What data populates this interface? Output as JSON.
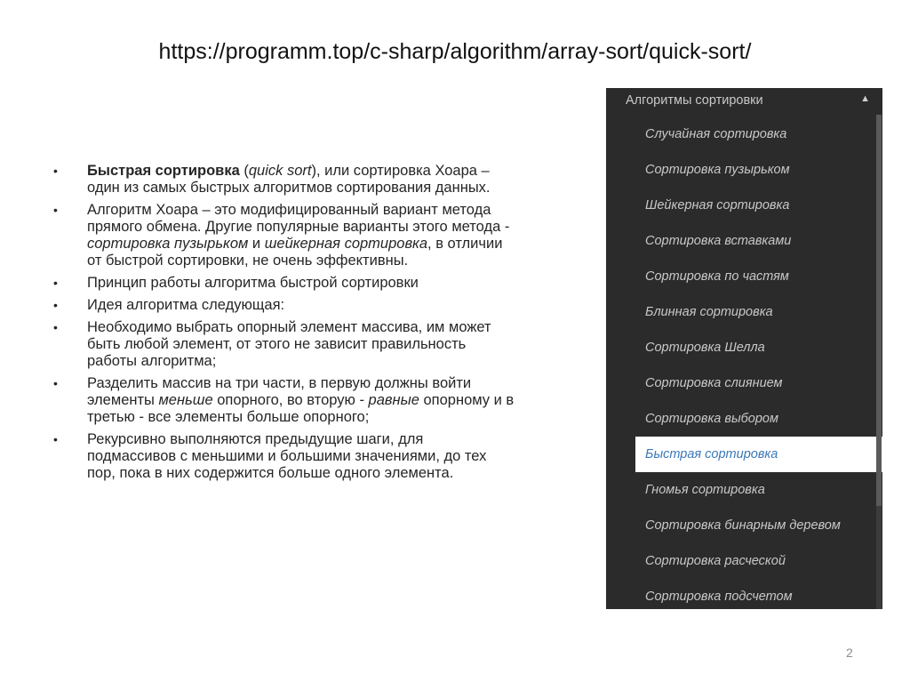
{
  "slide": {
    "title": "https://programm.top/c-sharp/algorithm/array-sort/quick-sort/",
    "page_number": "2"
  },
  "content": {
    "bullet_glyph": "•",
    "b1": {
      "bold": "Быстрая сортировка",
      "t1": " (",
      "i1": "quick sort",
      "t2": "), или сортировка Хоара – один из самых быстрых алгоритмов сортирования данных."
    },
    "b2": {
      "t1": "Алгоритм Хоара – это модифицированный вариант метода прямого обмена. Другие популярные варианты этого метода - ",
      "i1": "сортировка пузырьком",
      "t2": " и ",
      "i2": "шейкерная сортировка",
      "t3": ", в отличии от быстрой сортировки, не очень эффективны."
    },
    "b3": {
      "t1": "Принцип работы алгоритма быстрой сортировки"
    },
    "b4": {
      "t1": "Идея алгоритма следующая:"
    },
    "b5": {
      "t1": "Необходимо выбрать опорный элемент массива, им может быть любой элемент, от этого не зависит правильность работы алгоритма;"
    },
    "b6": {
      "t1": "Разделить массив на три части, в первую должны войти элементы ",
      "i1": "меньше",
      "t2": " опорного, во вторую -  ",
      "i2": "равные",
      "t3": " опорному и в третью - все элементы больше опорного;"
    },
    "b7": {
      "t1": "Рекурсивно выполняются предыдущие шаги, для подмассивов с меньшими и большими значениями, до тех пор, пока в них содержится больше одного элемента."
    }
  },
  "menu": {
    "header": "Алгоритмы сортировки",
    "collapse_arrow": "▲",
    "items": [
      "Случайная сортировка",
      "Сортировка пузырьком",
      "Шейкерная сортировка",
      "Сортировка вставками",
      "Сортировка по частям",
      "Блинная сортировка",
      "Сортировка Шелла",
      "Сортировка слиянием",
      "Сортировка выбором",
      "Быстрая сортировка",
      "Гномья сортировка",
      "Сортировка бинарным деревом",
      "Сортировка расческой",
      "Сортировка подсчетом"
    ],
    "active_index": 9,
    "colors": {
      "background": "#2b2b2b",
      "active_text": "#3a78b8",
      "text": "#c8c8c8"
    }
  }
}
